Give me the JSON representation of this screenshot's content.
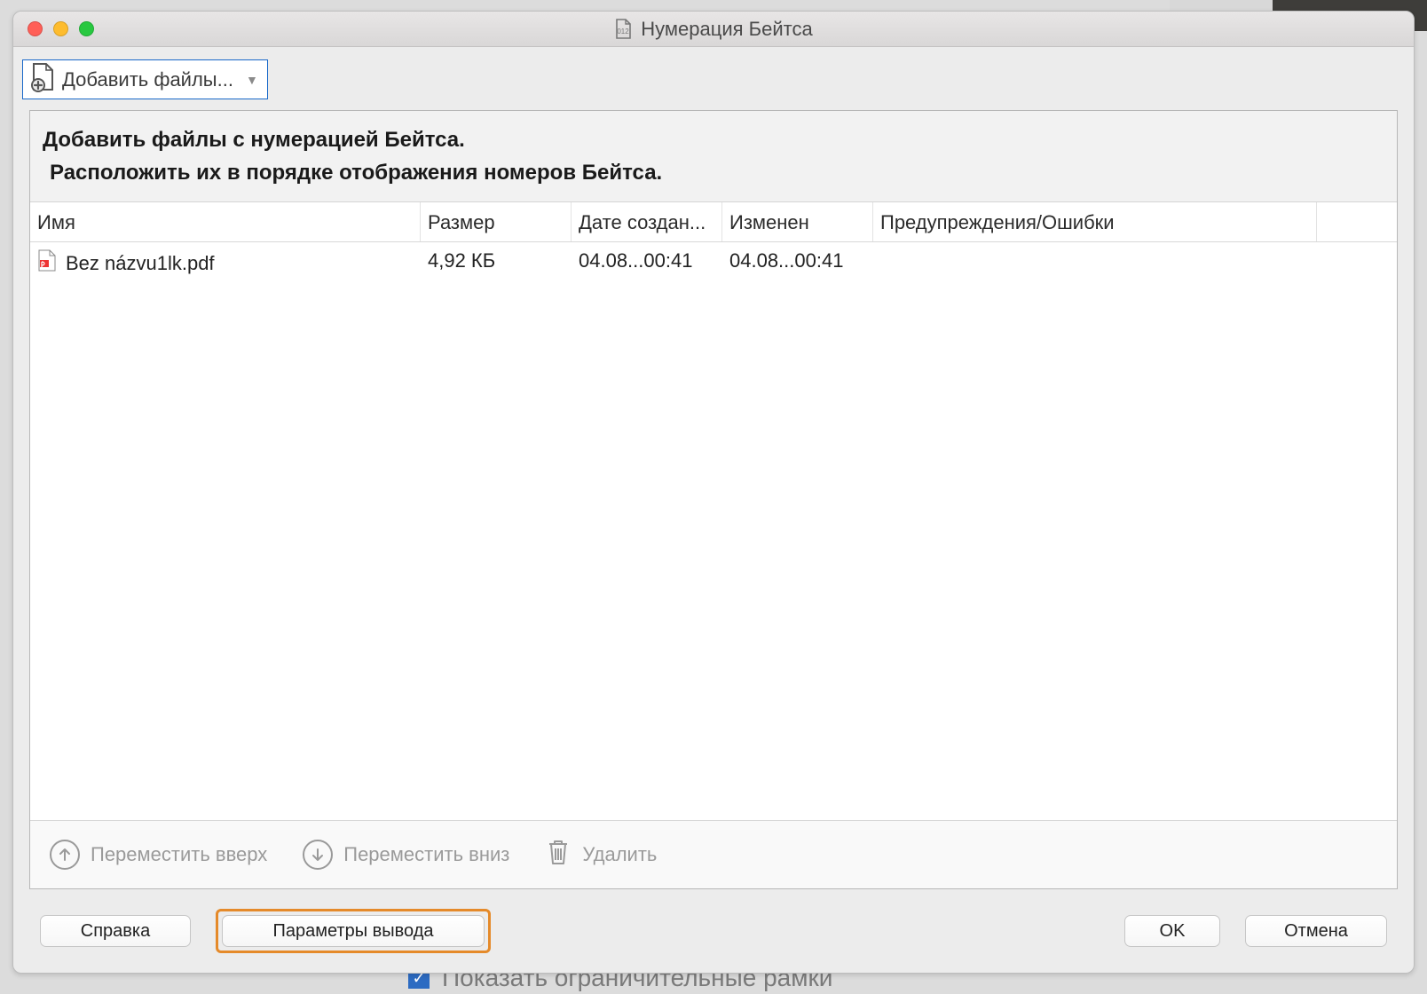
{
  "background": {
    "bottom_text": "Показать ограничительные рамки"
  },
  "window": {
    "title": "Нумерация Бейтса"
  },
  "toolbar": {
    "add_files_label": "Добавить файлы..."
  },
  "instructions": {
    "line1": "Добавить файлы с нумерацией Бейтса.",
    "line2": "Расположить их в порядке отображения номеров Бейтса."
  },
  "columns": {
    "name": "Имя",
    "size": "Размер",
    "created": "Дате создан...",
    "modified": "Изменен",
    "warnings": "Предупреждения/Ошибки"
  },
  "rows": [
    {
      "name": "Bez názvu1lk.pdf",
      "size": "4,92 КБ",
      "created": "04.08...00:41",
      "modified": "04.08...00:41",
      "warnings": ""
    }
  ],
  "list_actions": {
    "move_up": "Переместить вверх",
    "move_down": "Переместить вниз",
    "delete": "Удалить"
  },
  "buttons": {
    "help": "Справка",
    "output_options": "Параметры вывода",
    "ok": "OK",
    "cancel": "Отмена"
  }
}
